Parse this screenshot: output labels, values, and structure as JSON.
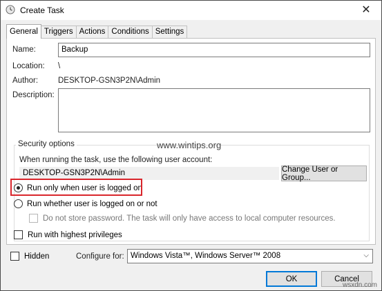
{
  "window": {
    "title": "Create Task",
    "close_glyph": "✕"
  },
  "tabs": [
    {
      "label": "General",
      "active": true
    },
    {
      "label": "Triggers",
      "active": false
    },
    {
      "label": "Actions",
      "active": false
    },
    {
      "label": "Conditions",
      "active": false
    },
    {
      "label": "Settings",
      "active": false
    }
  ],
  "general": {
    "name_label": "Name:",
    "name_value": "Backup",
    "location_label": "Location:",
    "location_value": "\\",
    "author_label": "Author:",
    "author_value": "DESKTOP-GSN3P2N\\Admin",
    "description_label": "Description:",
    "description_value": ""
  },
  "security": {
    "group_title": "Security options",
    "account_prompt": "When running the task, use the following user account:",
    "account_value": "DESKTOP-GSN3P2N\\Admin",
    "change_button": "Change User or Group...",
    "radio_logged_on": "Run only when user is logged on",
    "radio_whether": "Run whether user is logged on or not",
    "no_password_label": "Do not store password.  The task will only have access to local computer resources.",
    "highest_privileges": "Run with highest privileges"
  },
  "bottom": {
    "hidden_label": "Hidden",
    "configure_label": "Configure for:",
    "configure_value": "Windows Vista™, Windows Server™ 2008",
    "ok_button": "OK",
    "cancel_button": "Cancel"
  },
  "watermarks": {
    "main": "www.wintips.org",
    "corner": "wsxdn.com"
  },
  "colors": {
    "highlight_border": "#d9252b",
    "default_button_border": "#0078d7"
  }
}
